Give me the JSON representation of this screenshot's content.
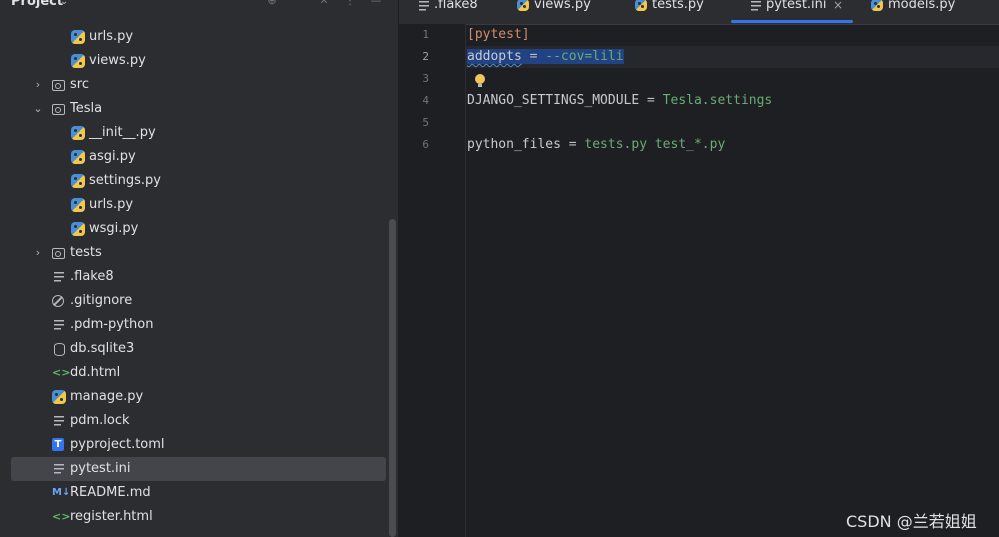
{
  "project_panel": {
    "title": "Project",
    "tree": [
      {
        "label": "urls.py",
        "icon": "python-file-icon",
        "depth": 2
      },
      {
        "label": "views.py",
        "icon": "python-file-icon",
        "depth": 2
      },
      {
        "label": "src",
        "icon": "folder-icon",
        "depth": 1,
        "expandable": true,
        "expanded": false
      },
      {
        "label": "Tesla",
        "icon": "folder-icon",
        "depth": 1,
        "expandable": true,
        "expanded": true
      },
      {
        "label": "__init__.py",
        "icon": "python-file-icon",
        "depth": 2
      },
      {
        "label": "asgi.py",
        "icon": "python-file-icon",
        "depth": 2
      },
      {
        "label": "settings.py",
        "icon": "python-file-icon",
        "depth": 2
      },
      {
        "label": "urls.py",
        "icon": "python-file-icon",
        "depth": 2
      },
      {
        "label": "wsgi.py",
        "icon": "python-file-icon",
        "depth": 2
      },
      {
        "label": "tests",
        "icon": "folder-icon",
        "depth": 1,
        "expandable": true,
        "expanded": false
      },
      {
        "label": ".flake8",
        "icon": "text-file-icon",
        "depth": 1
      },
      {
        "label": ".gitignore",
        "icon": "gitignore-icon",
        "depth": 1
      },
      {
        "label": ".pdm-python",
        "icon": "text-file-icon",
        "depth": 1
      },
      {
        "label": "db.sqlite3",
        "icon": "database-icon",
        "depth": 1
      },
      {
        "label": "dd.html",
        "icon": "html-file-icon",
        "depth": 1
      },
      {
        "label": "manage.py",
        "icon": "python-file-icon",
        "depth": 1
      },
      {
        "label": "pdm.lock",
        "icon": "text-file-icon",
        "depth": 1
      },
      {
        "label": "pyproject.toml",
        "icon": "toml-file-icon",
        "depth": 1
      },
      {
        "label": "pytest.ini",
        "icon": "text-file-icon",
        "depth": 1,
        "selected": true
      },
      {
        "label": "README.md",
        "icon": "markdown-file-icon",
        "depth": 1
      },
      {
        "label": "register.html",
        "icon": "html-file-icon",
        "depth": 1
      }
    ]
  },
  "tabs": [
    {
      "label": ".flake8",
      "icon": "text-file-icon"
    },
    {
      "label": "views.py",
      "icon": "python-file-icon"
    },
    {
      "label": "tests.py",
      "icon": "python-file-icon"
    },
    {
      "label": "pytest.ini",
      "icon": "text-file-icon",
      "active": true
    },
    {
      "label": "models.py",
      "icon": "python-file-icon"
    }
  ],
  "editor": {
    "line_numbers": [
      "1",
      "2",
      "3",
      "4",
      "5",
      "6"
    ],
    "current_line": "2",
    "lines": {
      "l1_section": "[pytest]",
      "l2_key": "addopts",
      "l2_eq": " = ",
      "l2_val": "--cov=lili",
      "l4_key": "DJANGO_SETTINGS_MODULE",
      "l4_eq": " = ",
      "l4_val": "Tesla.settings",
      "l6_key": "python_files",
      "l6_eq": " = ",
      "l6_val": "tests.py test_*.py"
    }
  },
  "watermark": "CSDN @兰若姐姐",
  "colors": {
    "accent": "#3574f0",
    "string_value": "#6aab73",
    "section": "#cf8e6d",
    "selection": "#214283"
  }
}
